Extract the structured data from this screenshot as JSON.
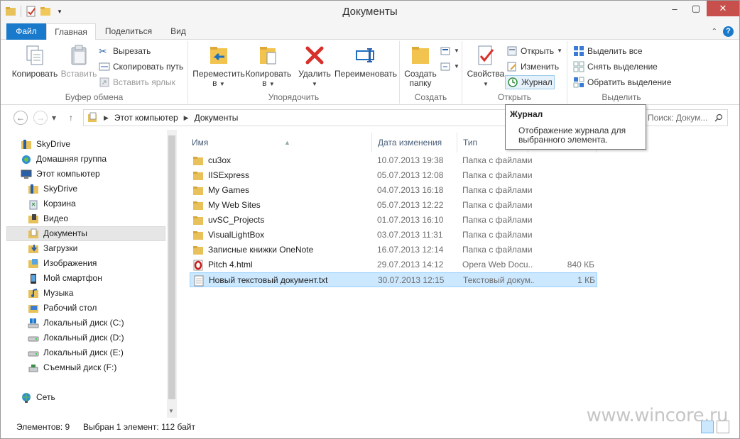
{
  "window": {
    "title": "Документы",
    "controls": {
      "minimize": "–",
      "maximize": "▢",
      "close": "✕"
    }
  },
  "tabs": [
    {
      "label": "Файл"
    },
    {
      "label": "Главная"
    },
    {
      "label": "Поделиться"
    },
    {
      "label": "Вид"
    }
  ],
  "ribbon": {
    "clipboard": {
      "group_label": "Буфер обмена",
      "copy": "Копировать",
      "paste": "Вставить",
      "cut": "Вырезать",
      "copy_path": "Скопировать путь",
      "paste_shortcut": "Вставить ярлык"
    },
    "organize": {
      "group_label": "Упорядочить",
      "move_to_line1": "Переместить",
      "move_to_line2": "в",
      "copy_to_line1": "Копировать",
      "copy_to_line2": "в",
      "delete": "Удалить",
      "rename": "Переименовать"
    },
    "create": {
      "group_label": "Создать",
      "new_folder_line1": "Создать",
      "new_folder_line2": "папку"
    },
    "open": {
      "group_label": "Открыть",
      "properties": "Свойства",
      "open": "Открыть",
      "edit": "Изменить",
      "history": "Журнал"
    },
    "select": {
      "group_label": "Выделить",
      "select_all": "Выделить все",
      "select_none": "Снять выделение",
      "invert": "Обратить выделение"
    }
  },
  "address": {
    "crumbs": [
      "Этот компьютер",
      "Документы"
    ],
    "search_placeholder": "Поиск: Докум..."
  },
  "tooltip": {
    "title": "Журнал",
    "body_line1": "Отображение журнала для",
    "body_line2": "выбранного элемента."
  },
  "nav": [
    {
      "label": "SkyDrive",
      "icon": "skydrive-icon",
      "indent": 0
    },
    {
      "label": "Домашняя группа",
      "icon": "homegroup-icon",
      "indent": 0
    },
    {
      "label": "Этот компьютер",
      "icon": "computer-icon",
      "indent": 0
    },
    {
      "label": "SkyDrive",
      "icon": "skydrive-icon",
      "indent": 1
    },
    {
      "label": "Корзина",
      "icon": "recycle-bin-icon",
      "indent": 1
    },
    {
      "label": "Видео",
      "icon": "videos-icon",
      "indent": 1
    },
    {
      "label": "Документы",
      "icon": "documents-icon",
      "indent": 1,
      "selected": true
    },
    {
      "label": "Загрузки",
      "icon": "downloads-icon",
      "indent": 1
    },
    {
      "label": "Изображения",
      "icon": "pictures-icon",
      "indent": 1
    },
    {
      "label": "Мой смартфон",
      "icon": "phone-icon",
      "indent": 1
    },
    {
      "label": "Музыка",
      "icon": "music-icon",
      "indent": 1
    },
    {
      "label": "Рабочий стол",
      "icon": "desktop-icon",
      "indent": 1
    },
    {
      "label": "Локальный диск (C:)",
      "icon": "system-drive-icon",
      "indent": 1
    },
    {
      "label": "Локальный диск (D:)",
      "icon": "drive-icon",
      "indent": 1
    },
    {
      "label": "Локальный диск (E:)",
      "icon": "drive-icon",
      "indent": 1
    },
    {
      "label": "Съемный диск (F:)",
      "icon": "removable-drive-icon",
      "indent": 1
    },
    {
      "label": "Сеть",
      "icon": "network-icon",
      "indent": 0
    }
  ],
  "columns": {
    "name": "Имя",
    "date": "Дата изменения",
    "type": "Тип",
    "size": ""
  },
  "files": [
    {
      "name": "cu3ox",
      "date": "10.07.2013 19:38",
      "type": "Папка с файлами",
      "size": "",
      "icon": "folder-icon"
    },
    {
      "name": "IISExpress",
      "date": "05.07.2013 12:08",
      "type": "Папка с файлами",
      "size": "",
      "icon": "folder-icon"
    },
    {
      "name": "My Games",
      "date": "04.07.2013 16:18",
      "type": "Папка с файлами",
      "size": "",
      "icon": "folder-icon"
    },
    {
      "name": "My Web Sites",
      "date": "05.07.2013 12:22",
      "type": "Папка с файлами",
      "size": "",
      "icon": "folder-icon"
    },
    {
      "name": "uvSC_Projects",
      "date": "01.07.2013 16:10",
      "type": "Папка с файлами",
      "size": "",
      "icon": "folder-icon"
    },
    {
      "name": "VisualLightBox",
      "date": "03.07.2013 11:31",
      "type": "Папка с файлами",
      "size": "",
      "icon": "folder-icon"
    },
    {
      "name": "Записные книжки OneNote",
      "date": "16.07.2013 12:14",
      "type": "Папка с файлами",
      "size": "",
      "icon": "folder-icon"
    },
    {
      "name": "Pitch 4.html",
      "date": "29.07.2013 14:12",
      "type": "Opera Web Docu...",
      "size": "840 КБ",
      "icon": "opera-html-icon"
    },
    {
      "name": "Новый текстовый документ.txt",
      "date": "30.07.2013 12:15",
      "type": "Текстовый докум...",
      "size": "1 КБ",
      "icon": "text-file-icon",
      "selected": true
    }
  ],
  "status": {
    "count": "Элементов: 9",
    "selection": "Выбран 1 элемент: 112 байт",
    "watermark": "www.wincore.ru"
  }
}
